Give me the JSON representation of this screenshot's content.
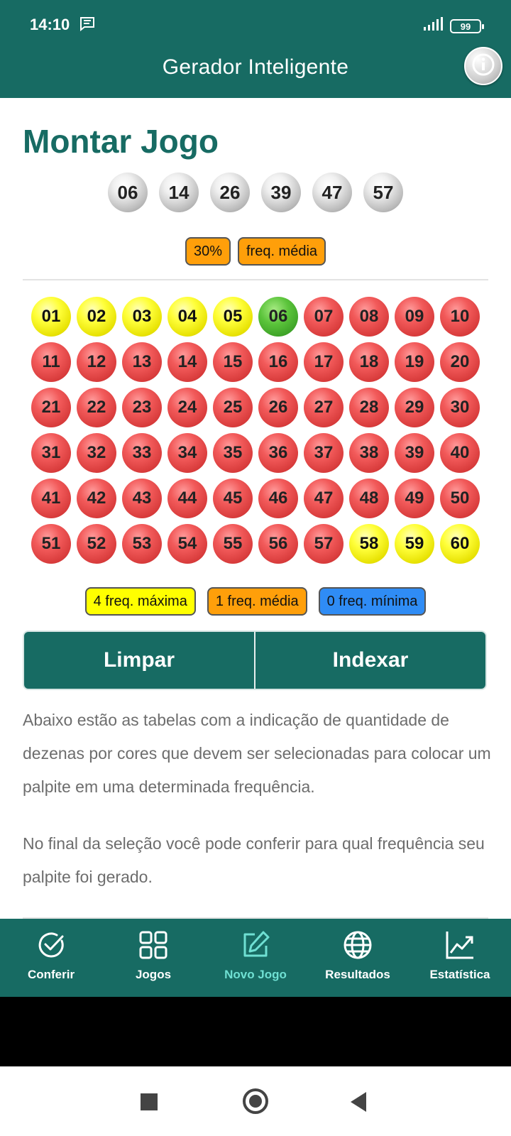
{
  "status_bar": {
    "time": "14:10",
    "battery": "99"
  },
  "header": {
    "title": "Gerador Inteligente",
    "info_icon": "info-icon"
  },
  "page": {
    "title": "Montar Jogo"
  },
  "selected_numbers": [
    "06",
    "14",
    "26",
    "39",
    "47",
    "57"
  ],
  "summary_tags": {
    "percent": "30%",
    "frequency": "freq. média"
  },
  "number_grid": [
    {
      "n": "01",
      "color": "yellow"
    },
    {
      "n": "02",
      "color": "yellow"
    },
    {
      "n": "03",
      "color": "yellow"
    },
    {
      "n": "04",
      "color": "yellow"
    },
    {
      "n": "05",
      "color": "yellow"
    },
    {
      "n": "06",
      "color": "green"
    },
    {
      "n": "07",
      "color": "red"
    },
    {
      "n": "08",
      "color": "red"
    },
    {
      "n": "09",
      "color": "red"
    },
    {
      "n": "10",
      "color": "red"
    },
    {
      "n": "11",
      "color": "red"
    },
    {
      "n": "12",
      "color": "red"
    },
    {
      "n": "13",
      "color": "red"
    },
    {
      "n": "14",
      "color": "red"
    },
    {
      "n": "15",
      "color": "red"
    },
    {
      "n": "16",
      "color": "red"
    },
    {
      "n": "17",
      "color": "red"
    },
    {
      "n": "18",
      "color": "red"
    },
    {
      "n": "19",
      "color": "red"
    },
    {
      "n": "20",
      "color": "red"
    },
    {
      "n": "21",
      "color": "red"
    },
    {
      "n": "22",
      "color": "red"
    },
    {
      "n": "23",
      "color": "red"
    },
    {
      "n": "24",
      "color": "red"
    },
    {
      "n": "25",
      "color": "red"
    },
    {
      "n": "26",
      "color": "red"
    },
    {
      "n": "27",
      "color": "red"
    },
    {
      "n": "28",
      "color": "red"
    },
    {
      "n": "29",
      "color": "red"
    },
    {
      "n": "30",
      "color": "red"
    },
    {
      "n": "31",
      "color": "red"
    },
    {
      "n": "32",
      "color": "red"
    },
    {
      "n": "33",
      "color": "red"
    },
    {
      "n": "34",
      "color": "red"
    },
    {
      "n": "35",
      "color": "red"
    },
    {
      "n": "36",
      "color": "red"
    },
    {
      "n": "37",
      "color": "red"
    },
    {
      "n": "38",
      "color": "red"
    },
    {
      "n": "39",
      "color": "red"
    },
    {
      "n": "40",
      "color": "red"
    },
    {
      "n": "41",
      "color": "red"
    },
    {
      "n": "42",
      "color": "red"
    },
    {
      "n": "43",
      "color": "red"
    },
    {
      "n": "44",
      "color": "red"
    },
    {
      "n": "45",
      "color": "red"
    },
    {
      "n": "46",
      "color": "red"
    },
    {
      "n": "47",
      "color": "red"
    },
    {
      "n": "48",
      "color": "red"
    },
    {
      "n": "49",
      "color": "red"
    },
    {
      "n": "50",
      "color": "red"
    },
    {
      "n": "51",
      "color": "red"
    },
    {
      "n": "52",
      "color": "red"
    },
    {
      "n": "53",
      "color": "red"
    },
    {
      "n": "54",
      "color": "red"
    },
    {
      "n": "55",
      "color": "red"
    },
    {
      "n": "56",
      "color": "red"
    },
    {
      "n": "57",
      "color": "red"
    },
    {
      "n": "58",
      "color": "yellow"
    },
    {
      "n": "59",
      "color": "yellow"
    },
    {
      "n": "60",
      "color": "yellow"
    }
  ],
  "legend": {
    "max": "4 freq. máxima",
    "mid": "1 freq. média",
    "min": "0 freq. mínima"
  },
  "actions": {
    "clear": "Limpar",
    "index": "Indexar"
  },
  "info_text": {
    "p1": "Abaixo estão as tabelas com a indicação de quantidade de dezenas por cores que devem ser selecionadas para colocar um palpite em uma determinada frequência.",
    "p2": "No final da seleção você pode conferir para qual frequência seu palpite foi gerado."
  },
  "bottom_nav": [
    {
      "label": "Conferir",
      "icon": "check-circle-icon"
    },
    {
      "label": "Jogos",
      "icon": "grid-icon"
    },
    {
      "label": "Novo Jogo",
      "icon": "edit-icon",
      "active": true
    },
    {
      "label": "Resultados",
      "icon": "globe-icon"
    },
    {
      "label": "Estatística",
      "icon": "chart-icon"
    }
  ],
  "colors": {
    "primary": "#176b63",
    "active_nav": "#6fe0d3",
    "ball_red": "#e04646",
    "ball_yellow": "#ffff00",
    "ball_green": "#4fb12e",
    "tag_orange": "#ff9f0a",
    "tag_blue": "#2f8cf5"
  }
}
